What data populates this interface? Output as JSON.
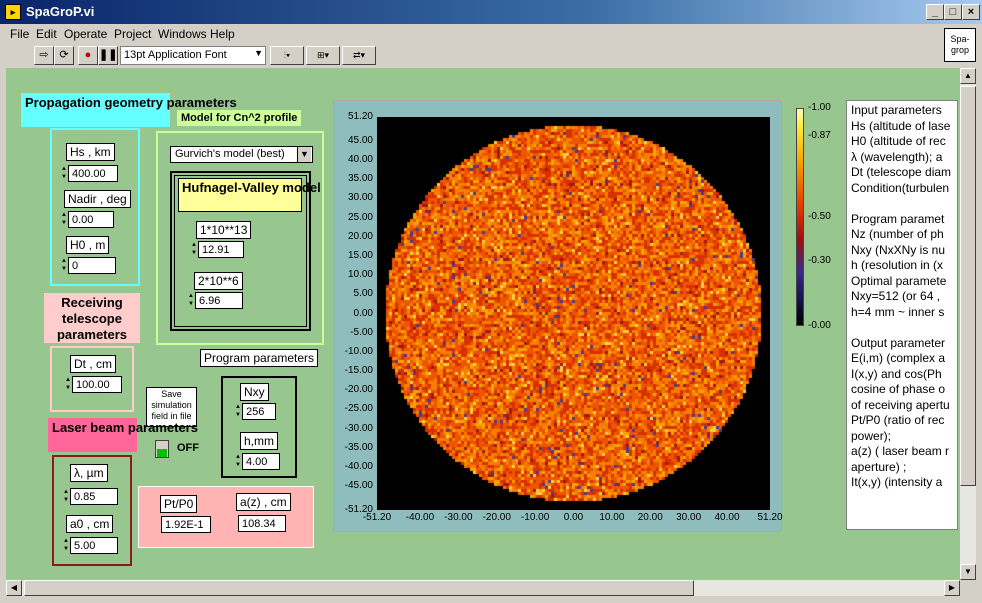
{
  "window": {
    "title": "SpaGroP.vi",
    "minimize": "_",
    "maximize": "□",
    "close": "×"
  },
  "menu": [
    "File",
    "Edit",
    "Operate",
    "Project",
    "Windows",
    "Help"
  ],
  "toolbar": {
    "font": "13pt Application Font",
    "vi_icon": "Spa-\ngrop"
  },
  "geometry": {
    "header": "Propagation geometry parameters",
    "hs_label": "Hs , km",
    "hs_value": "400.00",
    "nadir_label": "Nadir , deg",
    "nadir_value": "0.00",
    "h0_label": "H0 , m",
    "h0_value": "0"
  },
  "cn2": {
    "header": "Model for Cn^2 profile",
    "model_select": "Gurvich's model (best)",
    "hv_header": "Hufnagel-Valley model",
    "p1_label": "1*10**13",
    "p1_value": "12.91",
    "p2_label": "2*10**6",
    "p2_value": "6.96"
  },
  "receiving": {
    "header": "Receiving telescope parameters",
    "dt_label": "Dt , cm",
    "dt_value": "100.00"
  },
  "save": {
    "label": "Save simulation field in file",
    "state": "OFF"
  },
  "program": {
    "header": "Program parameters",
    "nxy_label": "Nxy",
    "nxy_value": "256",
    "h_label": "h,mm",
    "h_value": "4.00"
  },
  "laser": {
    "header": "Laser beam parameters",
    "lambda_label": "λ, µm",
    "lambda_value": "0.85",
    "a0_label": "a0 , cm",
    "a0_value": "5.00"
  },
  "output": {
    "pt_label": "Pt/P0",
    "pt_value": "1.92E-1",
    "az_label": "a(z) , cm",
    "az_value": "108.34"
  },
  "chart_data": {
    "type": "heatmap",
    "title": "",
    "xlim": [
      -51.2,
      51.2
    ],
    "ylim": [
      -51.2,
      51.2
    ],
    "x_ticks": [
      "-51.20",
      "-40.00",
      "-30.00",
      "-20.00",
      "-10.00",
      "0.00",
      "10.00",
      "20.00",
      "30.00",
      "40.00",
      "51.20"
    ],
    "y_ticks": [
      "51.20",
      "45.00",
      "40.00",
      "35.00",
      "30.00",
      "25.00",
      "20.00",
      "15.00",
      "10.00",
      "5.00",
      "0.00",
      "-5.00",
      "-10.00",
      "-15.00",
      "-20.00",
      "-25.00",
      "-30.00",
      "-35.00",
      "-40.00",
      "-45.00",
      "-51.20"
    ],
    "colorbar_ticks": [
      "1.00",
      "0.87",
      "0.50",
      "0.30",
      "0.00"
    ],
    "colorbar_values": [
      1.0,
      0.87,
      0.5,
      0.3,
      0.0
    ],
    "aperture_shape": "circle",
    "grid": false
  },
  "description": [
    "Input parameters",
    "Hs (altitude of lase",
    "H0 (altitude of rec",
    "λ (wavelength); a",
    "Dt (telescope diam",
    "Condition(turbulen",
    "",
    "Program paramet",
    "Nz (number of ph",
    "Nxy (NxXNy is nu",
    "h (resolution in (x",
    "Optimal paramete",
    "Nxy=512 (or 64 ,",
    "h=4 mm ~ inner s",
    "",
    "Output parameter",
    "E(i,m) (complex a",
    "I(x,y) and cos(Ph",
    "cosine of phase o",
    "of receiving apertu",
    "Pt/P0 (ratio of rec",
    "power);",
    "a(z) ( laser beam r",
    "aperture) ;",
    "It(x,y) (intensity a"
  ],
  "colors": {
    "panel": "#97c68f",
    "geometry_header": "#66ffff",
    "cn2_header": "#ccff99",
    "hv_header": "#ffff99",
    "receiving_header": "#ffcccc",
    "laser_header": "#ff6699",
    "output_frame": "#ffb3b3"
  }
}
